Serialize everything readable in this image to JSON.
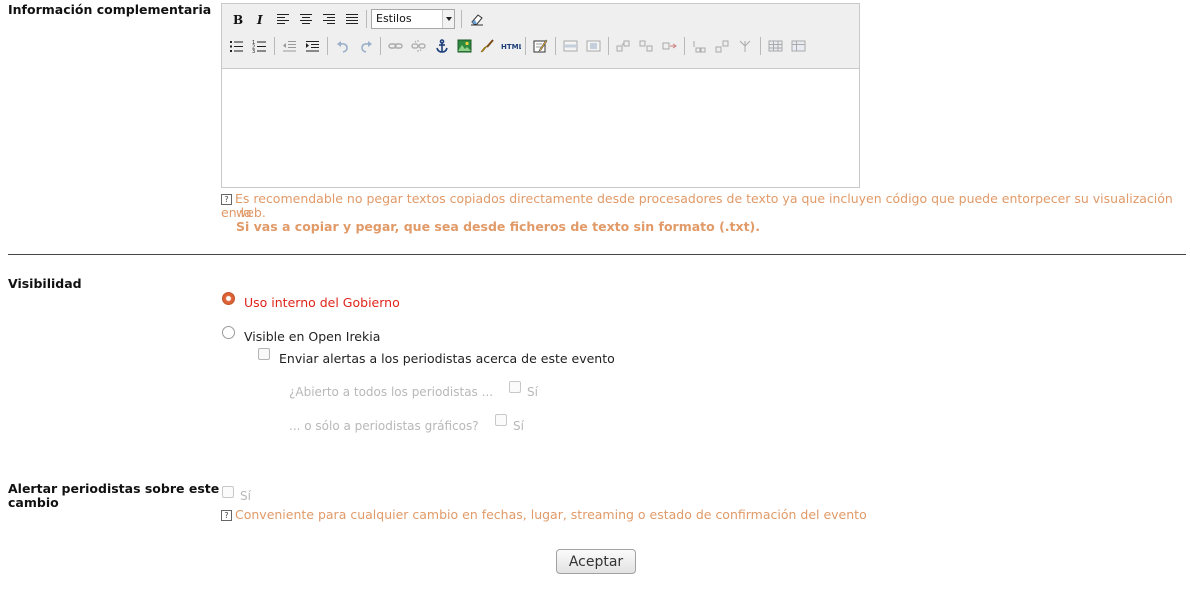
{
  "info": {
    "label": "Información complementaria",
    "toolbar": {
      "styles_value": "Estilos",
      "html_label": "HTML"
    },
    "hint_line1": "Es recomendable no pegar textos copiados directamente desde procesadores de texto ya que incluyen código que puede entorpecer su visualización en la",
    "hint_line2": "web.",
    "hint_bold": "Si vas a copiar y pegar, que sea desde ficheros de texto sin formato (.txt).",
    "hint_icon": "?"
  },
  "visibility": {
    "label": "Visibilidad",
    "option_internal": "Uso interno del Gobierno",
    "option_open": "Visible en Open Irekia",
    "send_alerts": "Enviar alertas a los periodistas acerca de este evento",
    "open_all_label": "¿Abierto a todos los periodistas ...",
    "open_all_yes": "Sí",
    "graphic_only_label": "... o sólo a periodistas gráficos?",
    "graphic_only_yes": "Sí"
  },
  "alert_change": {
    "label_line1": "Alertar periodistas sobre este",
    "label_line2": "cambio",
    "yes": "Sí",
    "hint": "Conveniente para cualquier cambio en fechas, lugar, streaming o estado de confirmación del evento",
    "hint_icon": "?"
  },
  "submit": {
    "label": "Aceptar"
  },
  "colors": {
    "hint": "#e19a68",
    "selected_option": "#e1241b",
    "radio_accent": "#dd6236"
  }
}
